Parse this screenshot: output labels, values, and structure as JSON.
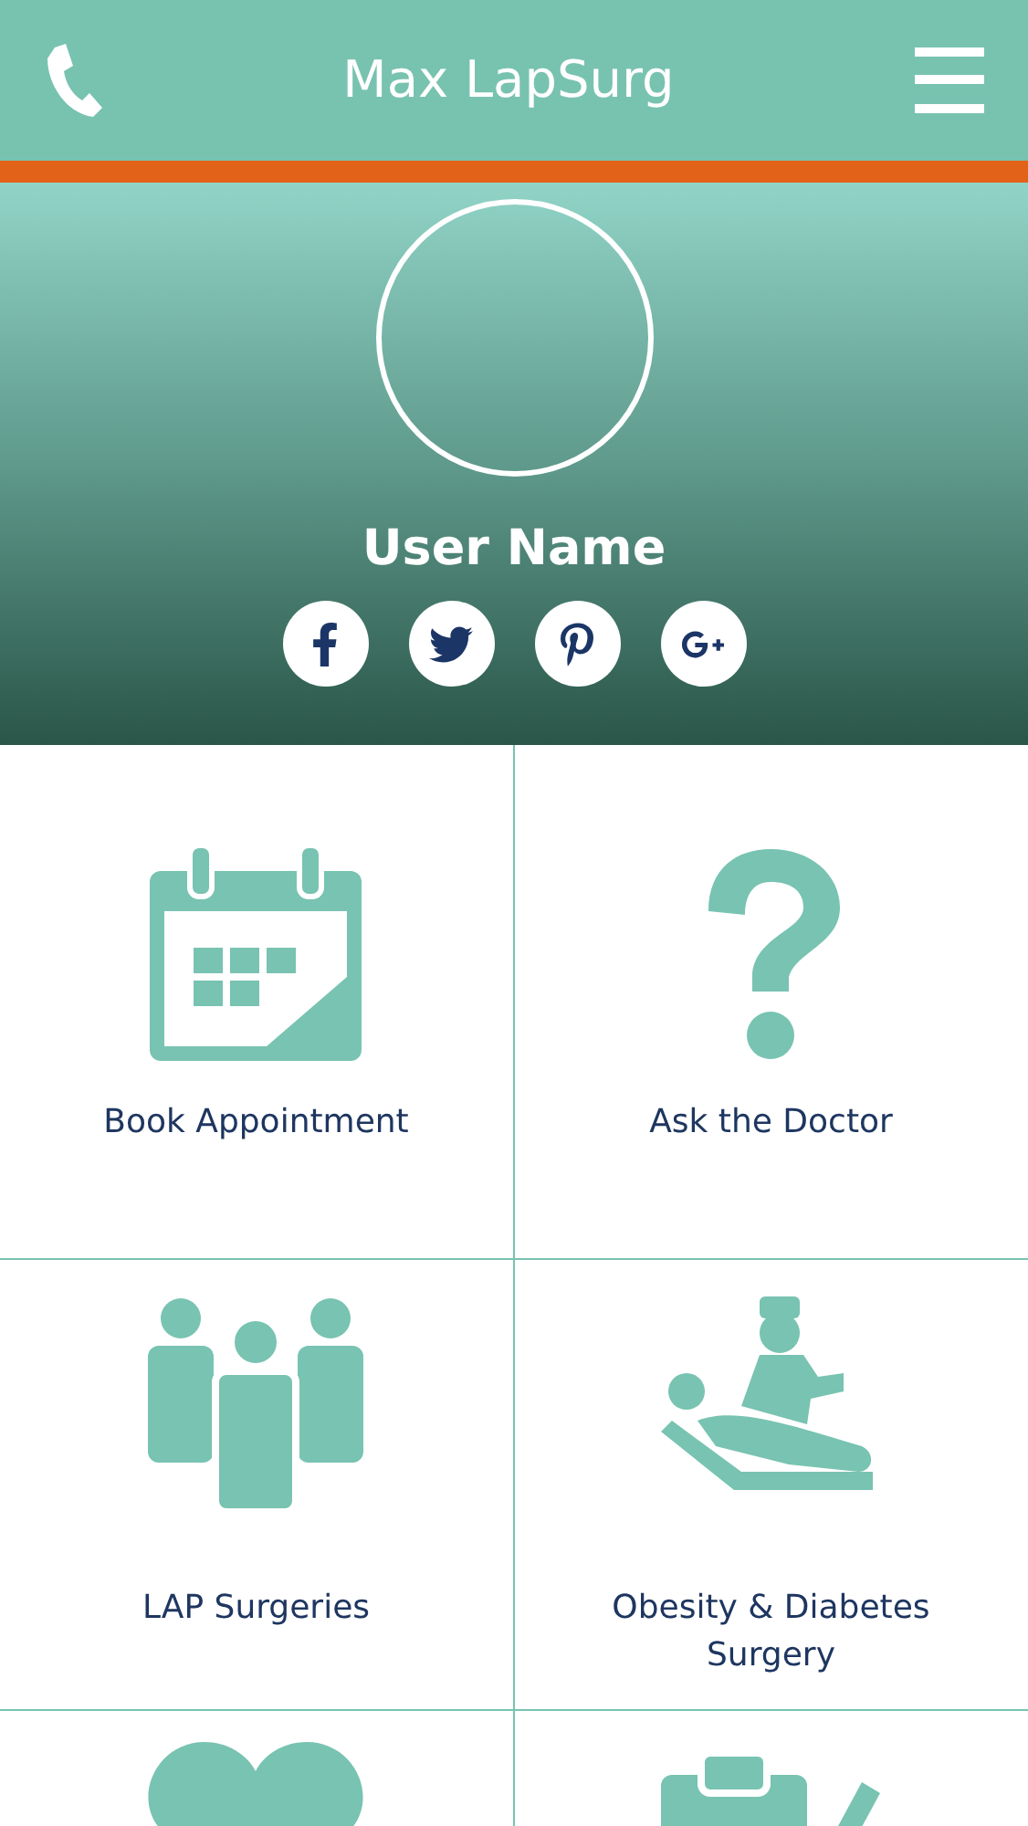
{
  "header": {
    "title": "Max LapSurg"
  },
  "profile": {
    "name": "User Name"
  },
  "social": [
    {
      "kind": "facebook"
    },
    {
      "kind": "twitter"
    },
    {
      "kind": "pinterest"
    },
    {
      "kind": "googleplus"
    }
  ],
  "tiles": [
    {
      "kind": "calendar",
      "label": "Book Appointment"
    },
    {
      "kind": "question",
      "label": "Ask the Doctor"
    },
    {
      "kind": "people",
      "label": "LAP Surgeries"
    },
    {
      "kind": "doctor",
      "label": "Obesity & Diabetes Surgery"
    },
    {
      "kind": "heart"
    },
    {
      "kind": "clipboard"
    }
  ]
}
